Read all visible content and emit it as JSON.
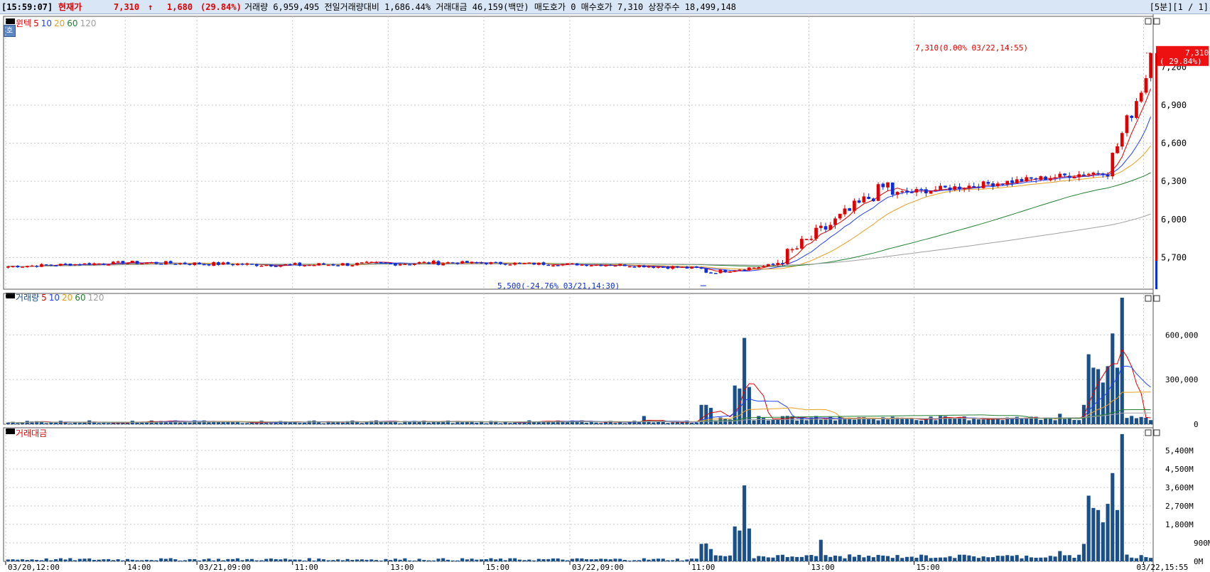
{
  "topbar": {
    "time": "[15:59:07]",
    "price_label": "현재가",
    "price": "7,310",
    "arrow": "↑",
    "change": "1,680",
    "change_pct": "(29.84%)",
    "info": "거래량 6,959,495 전일거래량대비 1,686.44% 거래대금 46,159(백만) 매도호가 0 매수호가 7,310 상장주수 18,499,148",
    "right": "[5분][1 / 1]"
  },
  "colors": {
    "up": "#e00000",
    "down": "#0b2fdd",
    "ma5": "#e00000",
    "ma10": "#2040ff",
    "ma20": "#e8a020",
    "ma60": "#208030",
    "ma120": "#a0a0a0",
    "vol": "#1a4f8a"
  },
  "legends": {
    "price": {
      "name": "윈텍",
      "ma": [
        "5",
        "10",
        "20",
        "60",
        "120"
      ]
    },
    "volume": {
      "name": "거래량",
      "ma": [
        "5",
        "10",
        "20",
        "60",
        "120"
      ]
    },
    "amount": {
      "name": "거래대금"
    }
  },
  "home_button": "호",
  "annotations": {
    "high": "7,310(0.00% 03/22,14:55)",
    "low": "5,500(-24.76% 03/21,14:30)",
    "price_tag": "7,310",
    "price_tag_pct": "( 29.84%)"
  },
  "chart_data": [
    {
      "type": "candlestick",
      "title": "윈텍",
      "y_ticks": [
        "7,200",
        "6,900",
        "6,600",
        "6,300",
        "6,000",
        "5,700"
      ],
      "ylim": [
        5450,
        7600
      ],
      "x_tick_labels": [
        "03/20,12:00",
        "14:00",
        "03/21,09:00",
        "11:00",
        "13:00",
        "15:00",
        "03/22,09:00",
        "11:00",
        "13:00",
        "15:00",
        "03/22,15:55"
      ],
      "n_bars": 240,
      "segments": [
        {
          "from": 0,
          "to": 25,
          "start": 5630,
          "end": 5660,
          "amp": 12
        },
        {
          "from": 25,
          "to": 60,
          "start": 5660,
          "end": 5640,
          "amp": 16
        },
        {
          "from": 60,
          "to": 92,
          "start": 5640,
          "end": 5660,
          "amp": 18
        },
        {
          "from": 92,
          "to": 130,
          "start": 5660,
          "end": 5640,
          "amp": 12
        },
        {
          "from": 130,
          "to": 146,
          "start": 5640,
          "end": 5610,
          "amp": 14
        },
        {
          "from": 146,
          "to": 160,
          "start": 5580,
          "end": 5640,
          "amp": 15
        },
        {
          "from": 160,
          "to": 185,
          "start": 5640,
          "end": 6300,
          "amp": 60
        },
        {
          "from": 185,
          "to": 230,
          "start": 6200,
          "end": 6380,
          "amp": 25
        },
        {
          "from": 230,
          "to": 240,
          "start": 6400,
          "end": 7310,
          "amp": 70
        }
      ],
      "moving_averages": [
        "5",
        "10",
        "20",
        "60",
        "120"
      ],
      "high": 7310,
      "low": 5500
    },
    {
      "type": "bar",
      "title": "거래량",
      "y_ticks": [
        "600,000",
        "300,000",
        "0"
      ],
      "ylim": [
        0,
        850000
      ],
      "spikes": [
        [
          133,
          55000
        ],
        [
          145,
          130000
        ],
        [
          146,
          130000
        ],
        [
          147,
          110000
        ],
        [
          149,
          45000
        ],
        [
          152,
          260000
        ],
        [
          153,
          240000
        ],
        [
          154,
          580000
        ],
        [
          155,
          250000
        ],
        [
          170,
          30000
        ],
        [
          197,
          40000
        ],
        [
          220,
          70000
        ],
        [
          225,
          130000
        ],
        [
          226,
          470000
        ],
        [
          227,
          380000
        ],
        [
          228,
          370000
        ],
        [
          229,
          280000
        ],
        [
          230,
          390000
        ],
        [
          231,
          610000
        ],
        [
          232,
          380000
        ],
        [
          233,
          850000
        ]
      ],
      "baseline": 20000
    },
    {
      "type": "bar",
      "title": "거래대금",
      "y_ticks": [
        "5,400M",
        "4,500M",
        "3,600M",
        "2,700M",
        "1,800M",
        "900M",
        "0M"
      ],
      "ylim": [
        0,
        6300
      ],
      "spikes": [
        [
          133,
          150
        ],
        [
          145,
          850
        ],
        [
          146,
          870
        ],
        [
          147,
          600
        ],
        [
          149,
          280
        ],
        [
          152,
          1700
        ],
        [
          153,
          1500
        ],
        [
          154,
          3700
        ],
        [
          155,
          1600
        ],
        [
          170,
          1050
        ],
        [
          197,
          250
        ],
        [
          220,
          500
        ],
        [
          225,
          850
        ],
        [
          226,
          3200
        ],
        [
          227,
          2600
        ],
        [
          228,
          2500
        ],
        [
          229,
          1900
        ],
        [
          230,
          2800
        ],
        [
          231,
          4300
        ],
        [
          232,
          2500
        ],
        [
          233,
          6200
        ]
      ],
      "baseline": 120
    }
  ]
}
